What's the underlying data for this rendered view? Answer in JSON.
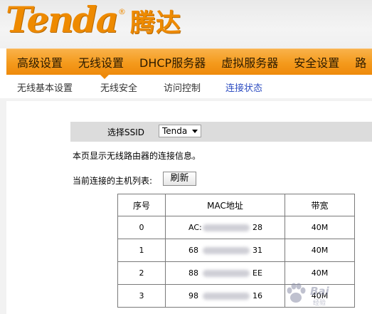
{
  "brand": {
    "logo_en": "Tenda",
    "logo_reg": "®",
    "logo_cn": "腾达",
    "accent_color": "#ee8a00"
  },
  "main_nav": {
    "items": [
      "高级设置",
      "无线设置",
      "DHCP服务器",
      "虚拟服务器",
      "安全设置",
      "路"
    ],
    "active": "无线设置"
  },
  "sub_nav": {
    "items": [
      "无线基本设置",
      "无线安全",
      "访问控制",
      "连接状态"
    ],
    "active": "连接状态",
    "active_color": "#2f4ec2"
  },
  "ssid": {
    "label": "选择SSID",
    "selected": "Tenda"
  },
  "description": "本页显示无线路由器的连接信息。",
  "host_list": {
    "label": "当前连接的主机列表:",
    "refresh_label": "刷新",
    "headers": [
      "序号",
      "MAC地址",
      "带宽"
    ],
    "rows": [
      {
        "idx": "0",
        "mac_prefix": "AC:",
        "mac_suffix": "28",
        "bandwidth": "40M"
      },
      {
        "idx": "1",
        "mac_prefix": "68",
        "mac_suffix": "31",
        "bandwidth": "40M"
      },
      {
        "idx": "2",
        "mac_prefix": "88",
        "mac_suffix": "EE",
        "bandwidth": "40M"
      },
      {
        "idx": "3",
        "mac_prefix": "98",
        "mac_suffix": "16",
        "bandwidth": "40M"
      }
    ]
  },
  "watermark": {
    "text": "Bai",
    "sub": "经验"
  }
}
